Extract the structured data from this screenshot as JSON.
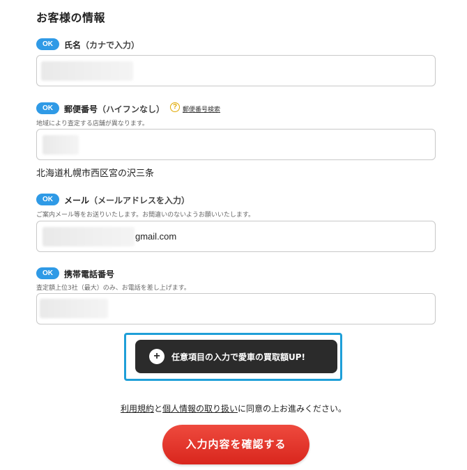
{
  "section": {
    "title": "お客様の情報"
  },
  "badge": {
    "ok_label": "OK"
  },
  "name": {
    "label": "氏名",
    "hint": "（カナで入力）"
  },
  "postal": {
    "label": "郵便番号",
    "hint": "（ハイフンなし）",
    "lookup_link": "郵便番号検索",
    "note": "地域により査定する店舗が異なります。",
    "address_result": "北海道札幌市西区宮の沢三条"
  },
  "email": {
    "label": "メール",
    "hint": "（メールアドレスを入力）",
    "note": "ご案内メール等をお送りいたします。お間違いのないようお願いいたします。",
    "visible_value": "gmail.com"
  },
  "phone": {
    "label": "携帯電話番号",
    "note": "査定額上位3社（最大）のみ、お電話を差し上げます。"
  },
  "optional_button": {
    "label": "任意項目の入力で愛車の買取額UP!",
    "icon": "plus-circle-icon"
  },
  "consent": {
    "terms_link": "利用規約",
    "and": "と",
    "privacy_link": "個人情報の取り扱い",
    "rest": "に同意の上お進みください。"
  },
  "confirm_button": {
    "label": "入力内容を確認する"
  },
  "colors": {
    "ok_badge": "#2f9ae6",
    "focus_ring": "#1e9fd8",
    "confirm": "#e0302a",
    "optional_bg": "#2b2b2b",
    "help_icon": "#e0a800"
  }
}
